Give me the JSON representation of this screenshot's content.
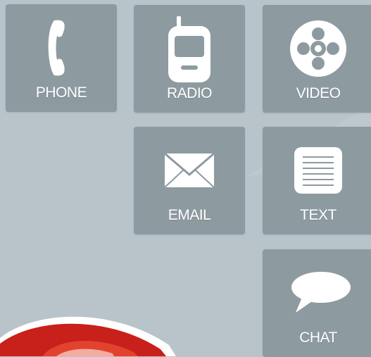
{
  "tiles": {
    "phone": {
      "label": "PHONE",
      "icon": "phone-handset-icon"
    },
    "radio": {
      "label": "RADIO",
      "icon": "walkie-talkie-icon"
    },
    "video": {
      "label": "VIDEO",
      "icon": "film-reel-icon"
    },
    "email": {
      "label": "EMAIL",
      "icon": "envelope-icon"
    },
    "text": {
      "label": "TEXT",
      "icon": "text-document-icon"
    },
    "chat": {
      "label": "CHAT",
      "icon": "speech-bubble-icon"
    }
  },
  "colors": {
    "background": "#b9c3ca",
    "tile": "#8d9ba1",
    "icon": "#ffffff",
    "mascot_red": "#c8201a"
  }
}
